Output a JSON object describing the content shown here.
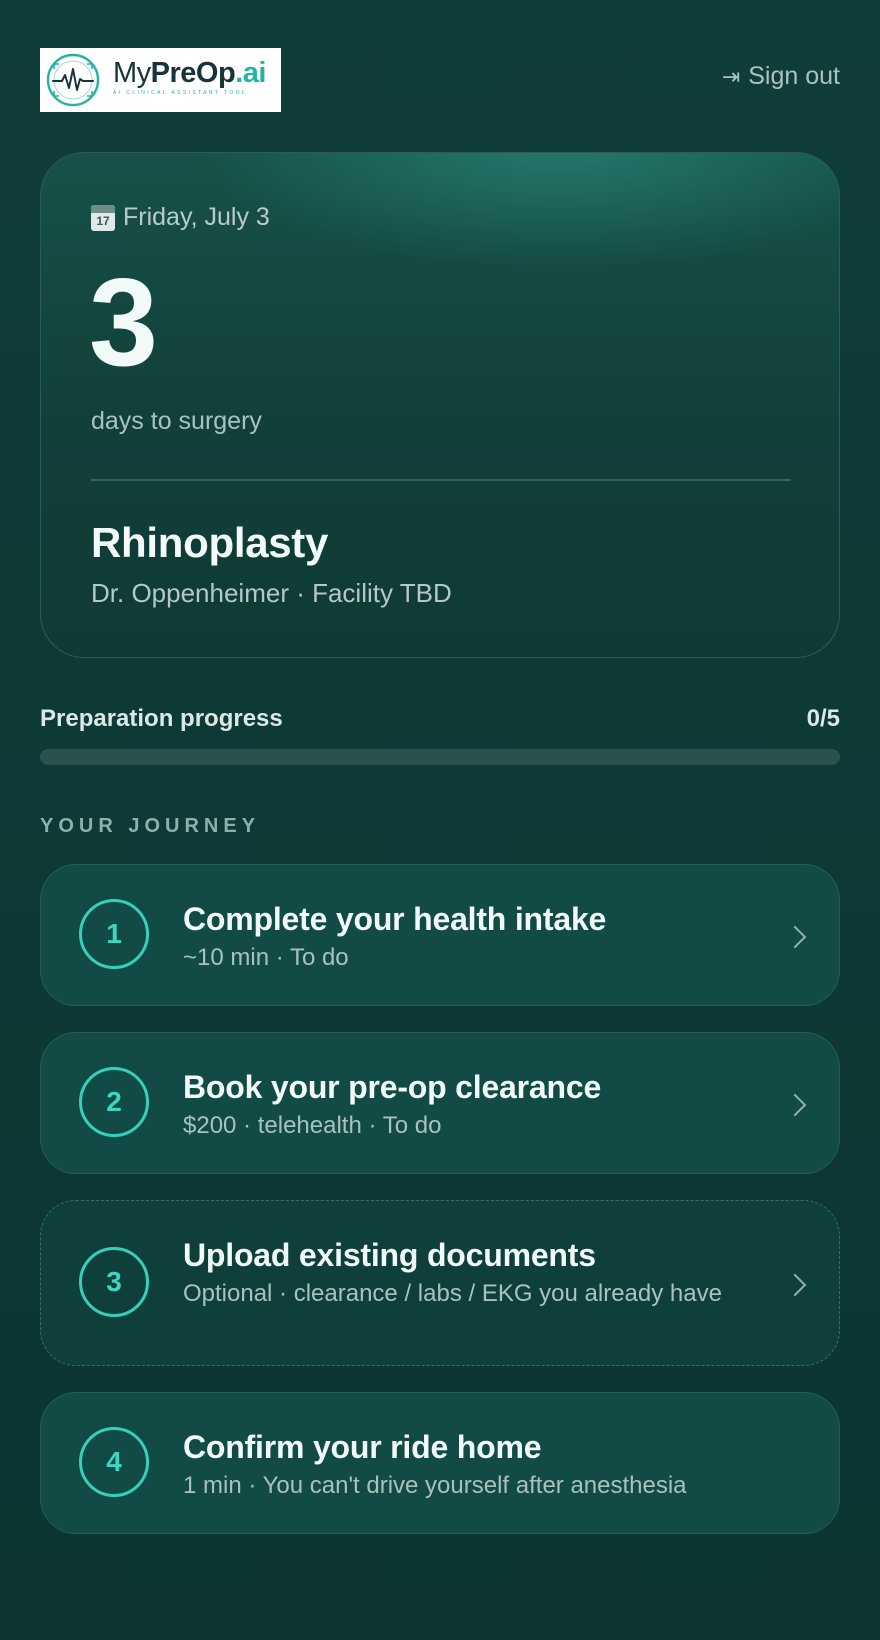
{
  "header": {
    "logo": {
      "brand_prefix": "My",
      "brand_bold": "PreOp",
      "brand_suffix": ".ai",
      "tagline": "AI CLINICAL ASSISTANT TOOL"
    },
    "signout_label": "Sign out",
    "signout_icon": "arrow-to-right-icon"
  },
  "hero": {
    "date": "Friday, July 3",
    "calendar_icon_day": "17",
    "days_count": "3",
    "days_label": "days to surgery",
    "procedure": "Rhinoplasty",
    "details": "Dr. Oppenheimer · Facility TBD"
  },
  "progress": {
    "label": "Preparation progress",
    "count_text": "0/5",
    "completed": 0,
    "total": 5
  },
  "journey": {
    "title": "YOUR JOURNEY",
    "steps": [
      {
        "number": "1",
        "title": "Complete your health intake",
        "subtitle": "~10 min · To do",
        "optional": false,
        "has_chevron": true
      },
      {
        "number": "2",
        "title": "Book your pre-op clearance",
        "subtitle": "$200 · telehealth · To do",
        "optional": false,
        "has_chevron": true
      },
      {
        "number": "3",
        "title": "Upload existing documents",
        "subtitle": "Optional · clearance / labs / EKG you already have",
        "optional": true,
        "has_chevron": true
      },
      {
        "number": "4",
        "title": "Confirm your ride home",
        "subtitle": "1 min · You can't drive yourself after anesthesia",
        "optional": false,
        "has_chevron": false
      }
    ]
  },
  "colors": {
    "background": "#0f3d39",
    "accent": "#34d0bb",
    "card": "#124a45"
  }
}
